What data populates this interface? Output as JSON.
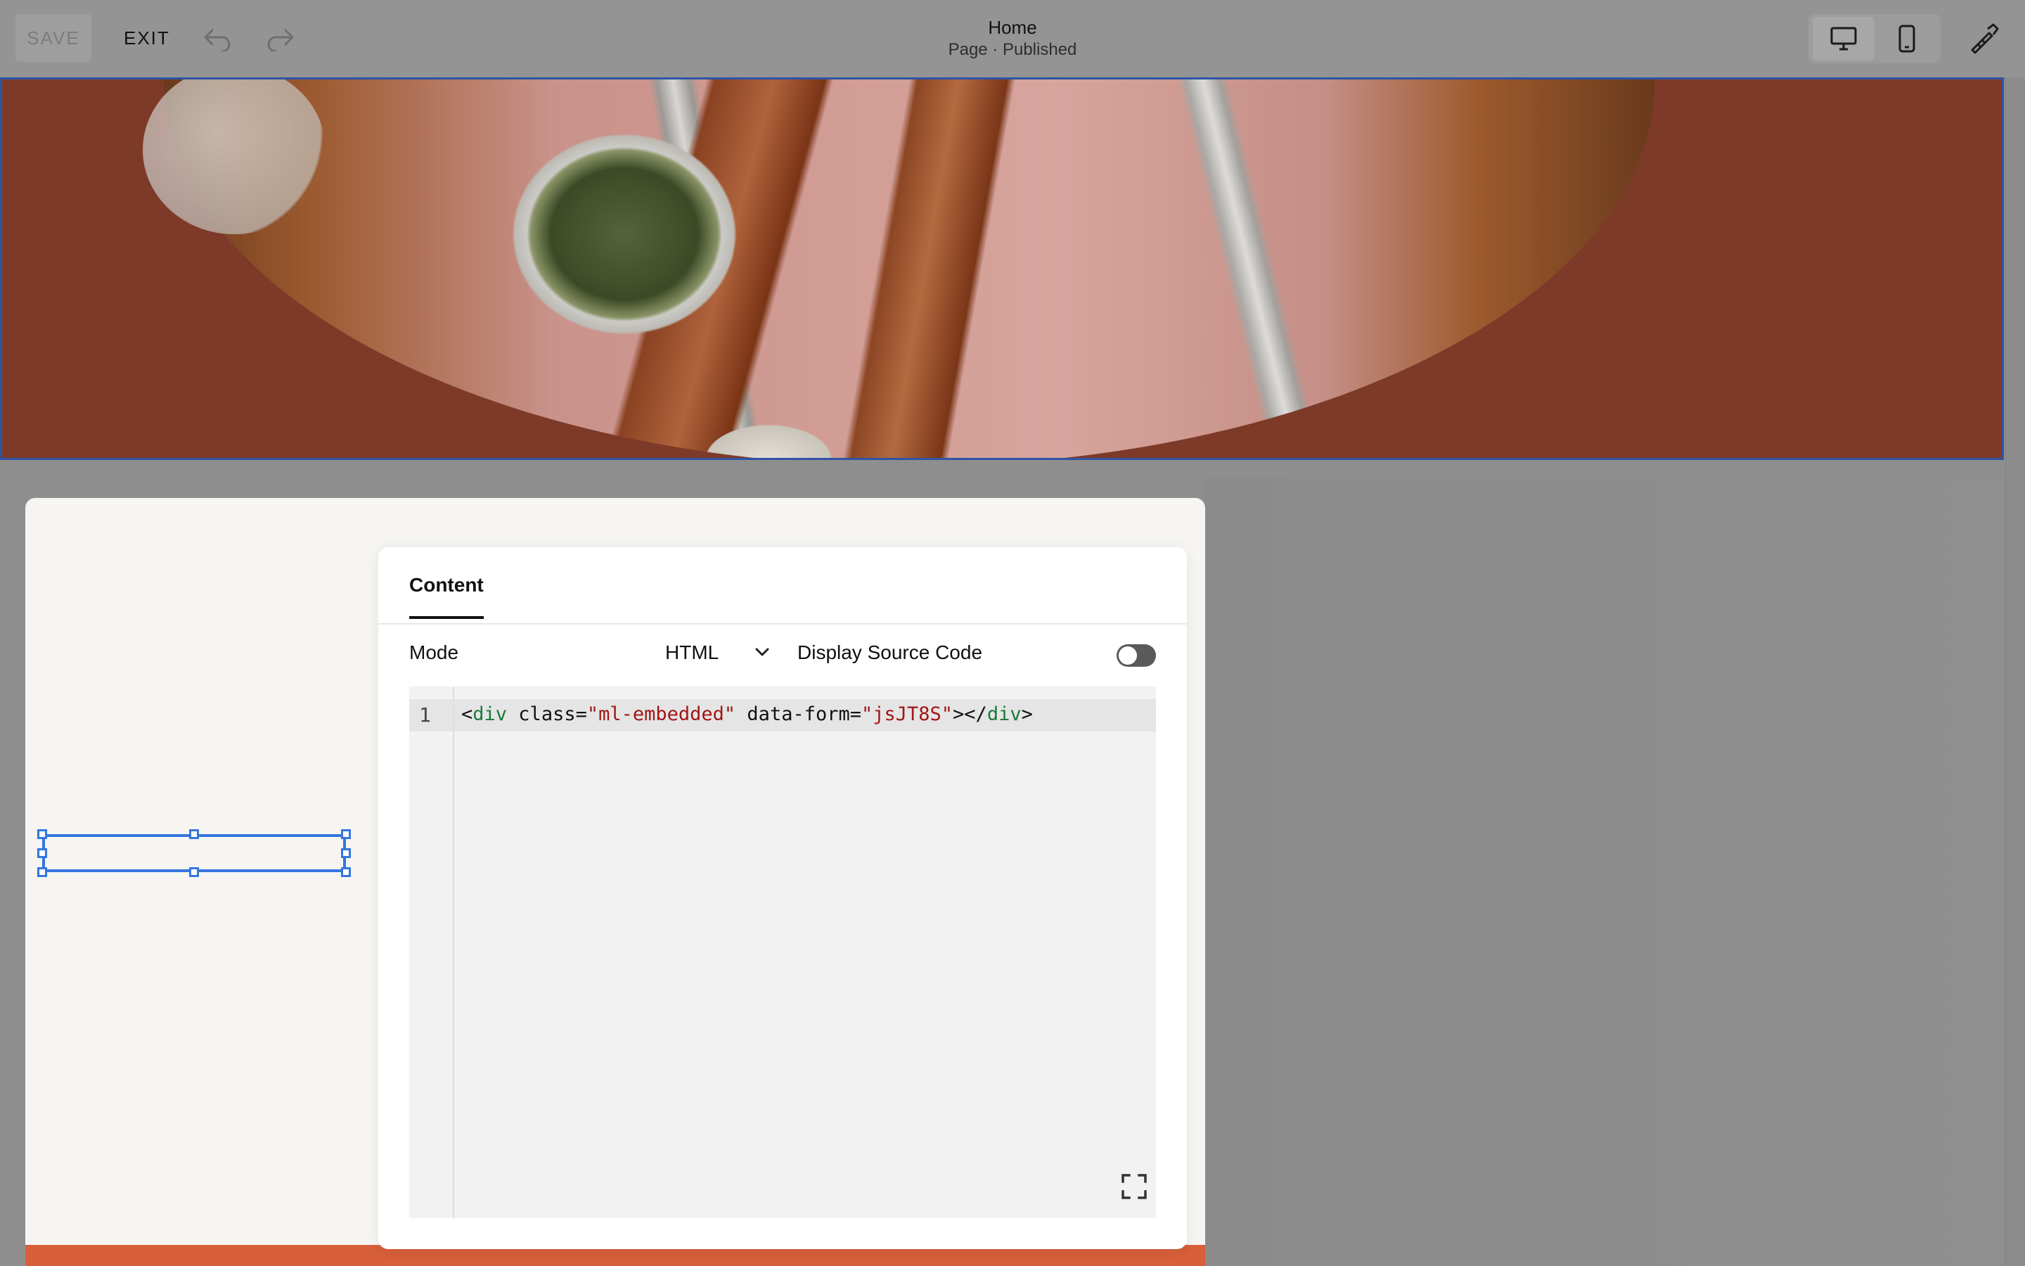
{
  "toolbar": {
    "save_label": "SAVE",
    "exit_label": "EXIT",
    "page_title": "Home",
    "page_status": "Page · Published"
  },
  "icons": {
    "undo": "undo-icon",
    "redo": "redo-icon",
    "desktop": "desktop-icon",
    "mobile": "mobile-icon",
    "design": "paintbrush-ruler-icon",
    "expand": "expand-icon"
  },
  "panel": {
    "tab_label": "Content",
    "mode_label": "Mode",
    "mode_value": "HTML",
    "display_source_label": "Display Source Code",
    "display_source_on": false
  },
  "code": {
    "line_number": "1",
    "tokens": [
      {
        "text": "<",
        "kind": "punct"
      },
      {
        "text": "div",
        "kind": "tag"
      },
      {
        "text": " class=",
        "kind": "attr"
      },
      {
        "text": "\"ml-embedded\"",
        "kind": "str"
      },
      {
        "text": " data-form=",
        "kind": "attr"
      },
      {
        "text": "\"jsJT8S\"",
        "kind": "str"
      },
      {
        "text": "></",
        "kind": "punct"
      },
      {
        "text": "div",
        "kind": "tag"
      },
      {
        "text": ">",
        "kind": "punct"
      }
    ]
  },
  "colors": {
    "hero_bg": "#7e3a28",
    "selection": "#3476e0",
    "bottom_band": "#d75f3a"
  }
}
